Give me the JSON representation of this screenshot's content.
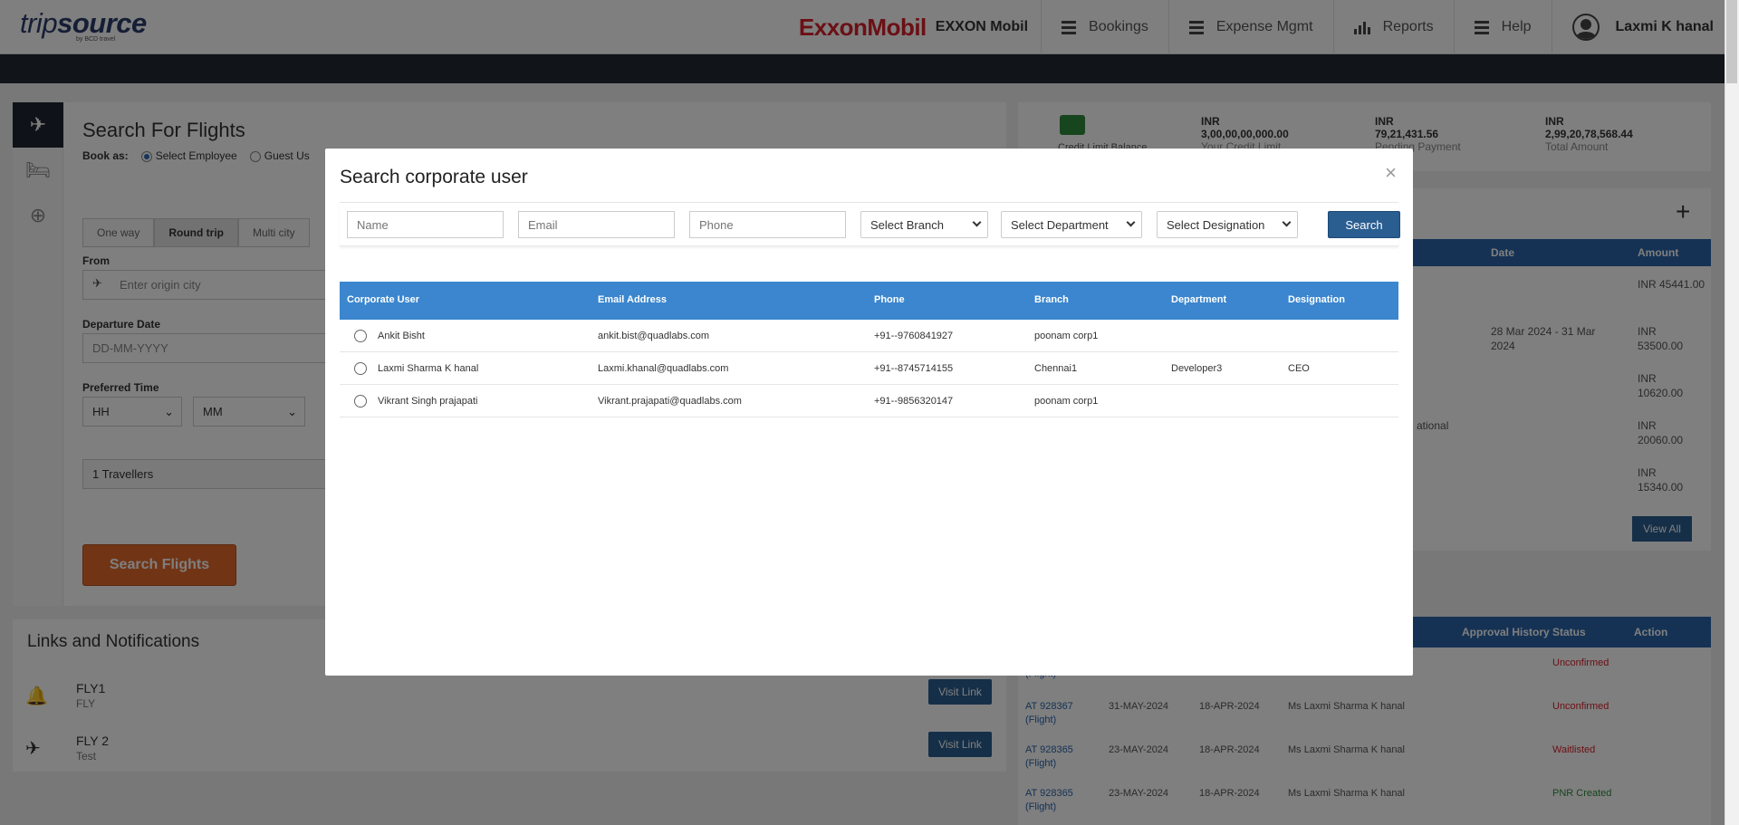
{
  "header": {
    "logo_text_light": "trip",
    "logo_text_bold": "source",
    "logo_sub": "by BCD travel",
    "brand_logo": "ExxonMobil",
    "brand_name": "EXXON Mobil",
    "nav": [
      "Bookings",
      "Expense Mgmt",
      "Reports",
      "Help"
    ],
    "user": "Laxmi K hanal"
  },
  "search_form": {
    "title": "Search For Flights",
    "book_as_label": "Book as:",
    "book_as_options": [
      "Select Employee",
      "Guest Us"
    ],
    "trip_types": [
      "One way",
      "Round trip",
      "Multi city"
    ],
    "from_label": "From",
    "from_placeholder": "Enter origin city",
    "departure_label": "Departure Date",
    "departure_placeholder": "DD-MM-YYYY",
    "time_label": "Preferred Time",
    "hh": "HH",
    "mm": "MM",
    "travellers": "1 Travellers",
    "submit": "Search Flights"
  },
  "links": {
    "title": "Links and Notifications",
    "items": [
      {
        "title": "FLY1",
        "sub": "FLY",
        "button": "Visit Link"
      },
      {
        "title": "FLY 2",
        "sub": "Test",
        "button": "Visit Link"
      }
    ]
  },
  "stats": [
    {
      "currency": "INR",
      "value": "3,00,00,00,000.00",
      "label": "Your Credit Limit"
    },
    {
      "currency": "INR",
      "value": "79,21,431.56",
      "label": "Pending Payment"
    },
    {
      "currency": "INR",
      "value": "2,99,20,78,568.44",
      "label": "Total Amount"
    }
  ],
  "stats_partial_label": "Credit Limit Balance",
  "right_table": {
    "headers": [
      "Date",
      "Amount"
    ],
    "rows": [
      {
        "date": "",
        "amount": "INR 45441.00",
        "extra": ""
      },
      {
        "date": "28 Mar 2024 - 31 Mar 2024",
        "amount": "INR 53500.00",
        "extra": ""
      },
      {
        "date": "",
        "amount": "INR 10620.00",
        "extra": ""
      },
      {
        "date": "",
        "amount": "INR 20060.00",
        "extra": "ational"
      },
      {
        "date": "",
        "amount": "INR 15340.00",
        "extra": ""
      }
    ],
    "view_all": "View All"
  },
  "bookings_table": {
    "headers": [
      "Approval History",
      "Status",
      "Action"
    ],
    "rows": [
      {
        "id": "",
        "type": "(Flight)",
        "d1": "",
        "d2": "",
        "name": "",
        "status": "Unconfirmed",
        "status_kind": "red"
      },
      {
        "id": "AT 928367",
        "type": "(Flight)",
        "d1": "31-MAY-2024",
        "d2": "18-APR-2024",
        "name": "Ms Laxmi Sharma K hanal",
        "status": "Unconfirmed",
        "status_kind": "red"
      },
      {
        "id": "AT 928365",
        "type": "(Flight)",
        "d1": "23-MAY-2024",
        "d2": "18-APR-2024",
        "name": "Ms Laxmi Sharma K hanal",
        "status": "Waitlisted",
        "status_kind": "red"
      },
      {
        "id": "AT 928365",
        "type": "(Flight)",
        "d1": "23-MAY-2024",
        "d2": "18-APR-2024",
        "name": "Ms Laxmi Sharma K hanal",
        "status": "PNR Created",
        "status_kind": "green"
      }
    ]
  },
  "modal": {
    "title": "Search corporate user",
    "close": "×",
    "filters": {
      "name_placeholder": "Name",
      "email_placeholder": "Email",
      "phone_placeholder": "Phone",
      "branch": "Select Branch",
      "department": "Select Department",
      "designation": "Select Designation",
      "search": "Search"
    },
    "columns": [
      "Corporate User",
      "Email Address",
      "Phone",
      "Branch",
      "Department",
      "Designation"
    ],
    "users": [
      {
        "name": "Ankit Bisht",
        "email": "ankit.bist@quadlabs.com",
        "phone": "+91--9760841927",
        "branch": "poonam corp1",
        "department": "",
        "designation": ""
      },
      {
        "name": "Laxmi Sharma K hanal",
        "email": "Laxmi.khanal@quadlabs.com",
        "phone": "+91--8745714155",
        "branch": "Chennai1",
        "department": "Developer3",
        "designation": "CEO"
      },
      {
        "name": "Vikrant Singh prajapati",
        "email": "Vikrant.prajapati@quadlabs.com",
        "phone": "+91--9856320147",
        "branch": "poonam corp1",
        "department": "",
        "designation": ""
      }
    ]
  },
  "colors": {
    "accent": "#2a5e91",
    "table_head": "#3b86ce",
    "brand_red": "#d6212a",
    "cta_orange": "#e26a2c"
  }
}
